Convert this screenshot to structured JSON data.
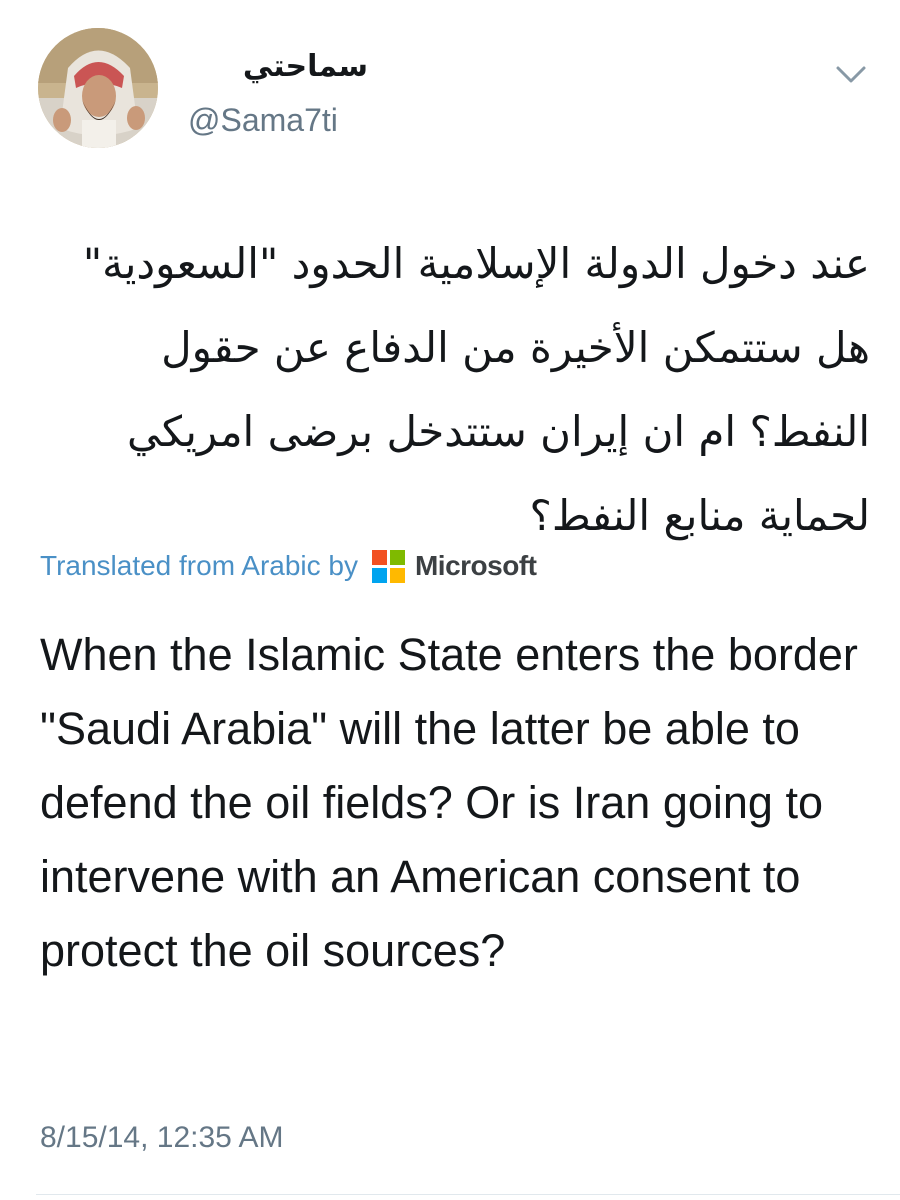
{
  "tweet": {
    "display_name": "سماحتي",
    "handle": "@Sama7ti",
    "menu_icon": "chevron-down-icon",
    "text_arabic": "عند دخول الدولة الإسلامية الحدود \"السعودية\" هل ستتمكن الأخيرة من الدفاع عن حقول النفط؟ ام ان إيران ستتدخل برضى امريكي لحماية منابع النفط؟",
    "translation": {
      "label": "Translated from Arabic by",
      "provider": "Microsoft",
      "provider_icon": "microsoft-logo-icon"
    },
    "text_english": "When the Islamic State enters the border \"Saudi Arabia\" will the latter be able to defend the oil fields? Or is Iran going to intervene with an American consent to protect the oil sources?",
    "timestamp": "8/15/14, 12:35 AM"
  },
  "colors": {
    "link": "#4a90c6",
    "secondary_text": "#657786",
    "primary_text": "#14171a",
    "ms_red": "#f25022",
    "ms_green": "#7fba00",
    "ms_blue": "#00a4ef",
    "ms_yellow": "#ffb900"
  }
}
